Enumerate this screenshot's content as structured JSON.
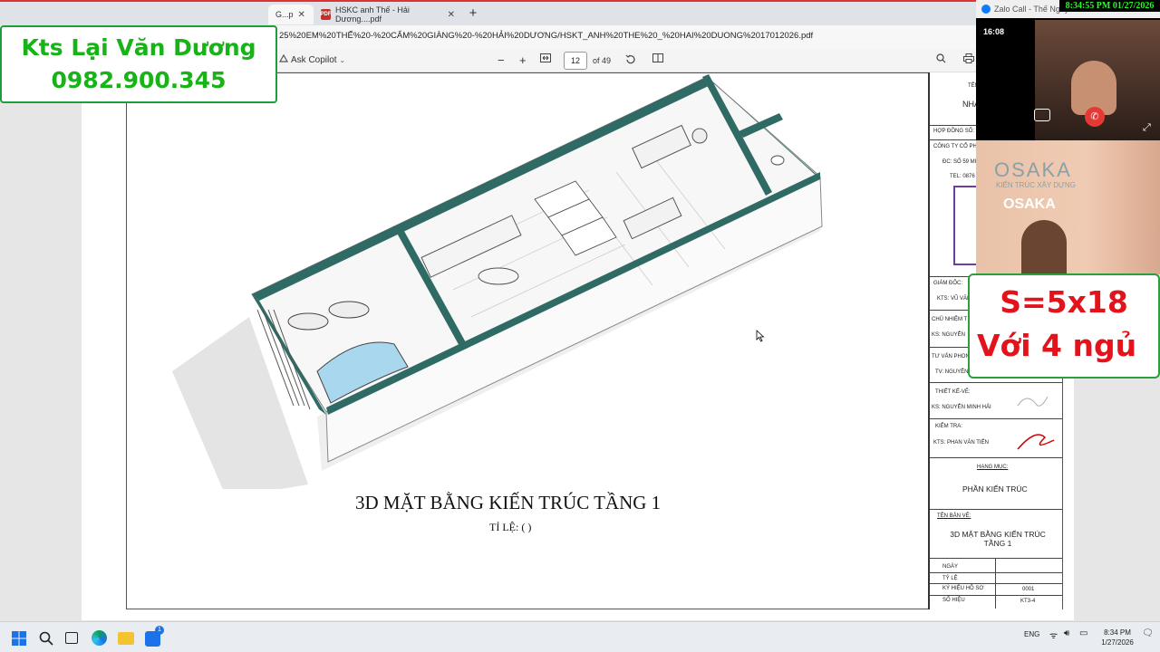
{
  "browser": {
    "tabs": [
      {
        "label": "G...p",
        "active": true
      },
      {
        "label": "HSKC anh Thế - Hải Dương....pdf",
        "active": false
      }
    ],
    "url": "25%20EM%20THẾ%20-%20CẨM%20GIÀNG%20-%20HẢI%20DƯƠNG/HSKT_ANH%20THE%20_%20HAI%20DUONG%2017012026.pdf"
  },
  "pdf_toolbar": {
    "ask_copilot": "Ask Copilot",
    "page_current": "12",
    "page_total": "of 49"
  },
  "drawing": {
    "title": "3D MẶT BẰNG KIẾN TRÚC TẦNG 1",
    "scale": "TỈ LỆ: ( )"
  },
  "title_block": {
    "ten": "TÊN",
    "nha": "NHÀ",
    "hop_dong": "HỢP ĐỒNG SỐ:",
    "cong_ty": "CÔNG TY CỔ PH",
    "dia_chi": "ĐC: SỐ 59 MI",
    "tel": "TEL: 0876",
    "giam_doc": "GIÁM ĐỐC:",
    "giam_doc_name": "KTS: VŨ VĂN",
    "chu_nhiem": "CHỦ NHIỆM T",
    "chu_nhiem_name": "KS: NGUYỄN",
    "tu_van": "TƯ VẤN PHON",
    "tu_van_name": "TV: NGUYỄN",
    "thiet_ke": "THIẾT KẾ-VẼ:",
    "thiet_ke_name": "KS: NGUYỄN MINH HẢI",
    "kiem_tra": "KIỂM TRA:",
    "kiem_tra_name": "KTS: PHAN VĂN TIẾN",
    "hang_muc_label": "HẠNG MỤC:",
    "hang_muc_value": "PHẦN KIẾN TRÚC",
    "ten_ban_ve_label": "TÊN BẢN VẼ:",
    "ten_ban_ve_value": "3D MẶT BẰNG KIẾN TRÚC TẦNG 1",
    "ngay": "NGÀY",
    "ty_le": "TỶ LỆ",
    "ky_hieu_ho_so": "KÝ HIỆU HỒ SƠ",
    "ky_hieu_ho_so_value": "0001",
    "so_hieu": "SỐ HIỆU",
    "so_hieu_value": "KT3-4"
  },
  "banner": {
    "name": "Kts Lại Văn Dương",
    "phone": "0982.900.345"
  },
  "call": {
    "app": "Zalo Call - Thế Nguy",
    "duration": "16:08",
    "timestamp": "8:34:55 PM 01/27/2026"
  },
  "webcam": {
    "sign_top": "OSAKA",
    "sign_mid": "KIẾN TRÚC XÂY DỰNG",
    "sign_bottom": "OSAKA"
  },
  "info_box": {
    "line1": "S=5x18",
    "line2": "Với 4 ngủ"
  },
  "taskbar": {
    "lang": "ENG",
    "time": "8:34 PM",
    "date": "1/27/2026",
    "badge": "1"
  },
  "colors": {
    "banner_green": "#17b317",
    "info_red": "#e4121a",
    "wall_teal": "#2f6b64",
    "clock_green": "#22ff22"
  }
}
